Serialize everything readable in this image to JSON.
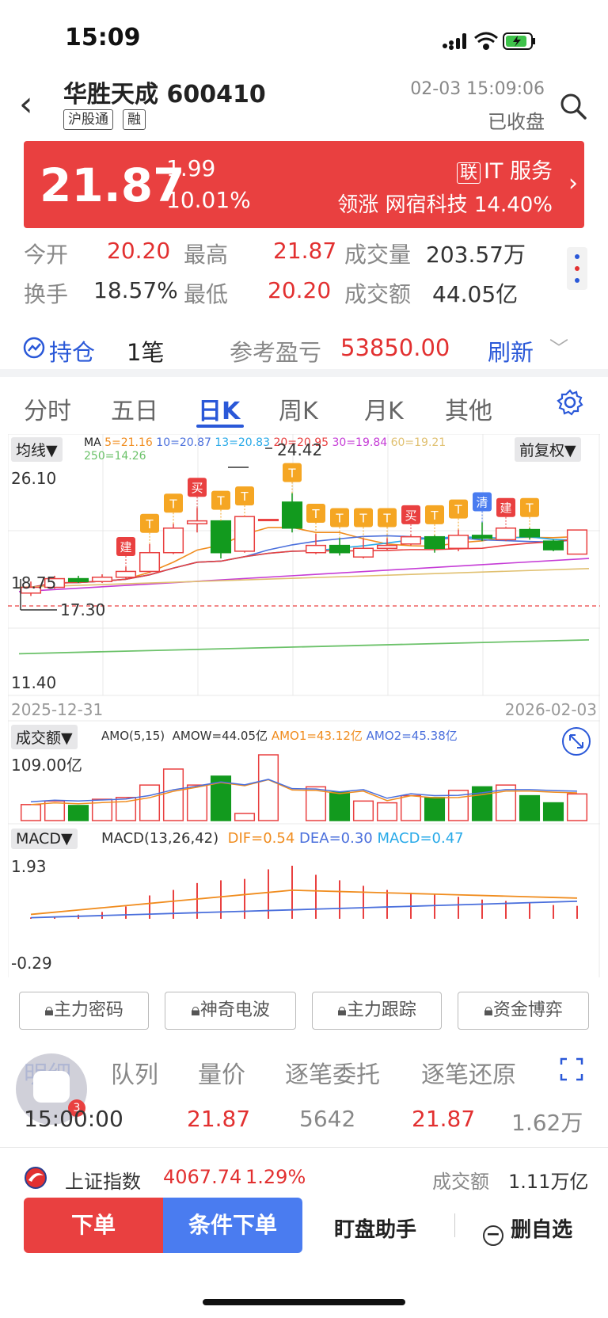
{
  "status_bar": {
    "time": "15:09"
  },
  "header": {
    "back_label": "‹",
    "stock_name": "华胜天成 600410",
    "tags": [
      "沪股通",
      "融"
    ],
    "datetime": "02-03 15:09:06",
    "market_status": "已收盘"
  },
  "quote": {
    "price": "21.87",
    "change": "1.99",
    "change_pct": "10.01%",
    "sector_badge": "联",
    "sector": "IT 服务",
    "leader_label": "领涨",
    "leader_name": "网宿科技",
    "leader_pct": "14.40%",
    "colors": {
      "up": "#e94040",
      "down": "#129a1e",
      "accent": "#2a58d8"
    }
  },
  "stats": {
    "open_label": "今开",
    "open": "20.20",
    "high_label": "最高",
    "high": "21.87",
    "volume_label": "成交量",
    "volume": "203.57万",
    "turnover_label": "换手",
    "turnover": "18.57%",
    "low_label": "最低",
    "low": "20.20",
    "amount_label": "成交额",
    "amount": "44.05亿"
  },
  "holding": {
    "label": "持仓",
    "count": "1笔",
    "pnl_label": "参考盈亏",
    "pnl": "53850.00",
    "refresh": "刷新"
  },
  "tabs": [
    "分时",
    "五日",
    "日K",
    "周K",
    "月K",
    "其他"
  ],
  "active_tab": "日K",
  "kline": {
    "indicator_btn": "均线▼",
    "ma_label": "MA",
    "ma": [
      {
        "label": "5=21.16",
        "color": "#f08c1e"
      },
      {
        "label": "10=20.87",
        "color": "#4a6fdc"
      },
      {
        "label": "13=20.83",
        "color": "#27a9e8"
      },
      {
        "label": "20=20.95",
        "color": "#e84040"
      },
      {
        "label": "30=19.84",
        "color": "#c53cd6"
      },
      {
        "label": "60=19.21",
        "color": "#e0c070"
      },
      {
        "label": "250=14.26",
        "color": "#6cc26a"
      }
    ],
    "adjust_btn": "前复权▼",
    "y_top": "26.10",
    "y_mid": "18.75",
    "y_bottom": "11.40",
    "max_label": "24.42",
    "min_label": "17.30",
    "date_start": "2025-12-31",
    "date_end": "2026-02-03",
    "signals": [
      "建",
      "T",
      "T",
      "买",
      "T",
      "T",
      "T",
      "T",
      "T",
      "T",
      "T",
      "买",
      "T",
      "T",
      "清",
      "建",
      "T"
    ]
  },
  "amount_panel": {
    "btn": "成交额▼",
    "amo": "AMO(5,15)",
    "amow": "AMOW=44.05亿",
    "amo1": "AMO1=43.12亿",
    "amo2": "AMO2=45.38亿",
    "y_top": "109.00亿"
  },
  "macd_panel": {
    "btn": "MACD▼",
    "macd": "MACD(13,26,42)",
    "dif": "DIF=0.54",
    "dea": "DEA=0.30",
    "macd_val": "MACD=0.47",
    "y_top": "1.93",
    "y_bottom": "-0.29"
  },
  "chart_data": {
    "type": "candlestick",
    "dates_range": [
      "2025-12-31",
      "2026-02-03"
    ],
    "ylim": [
      11.4,
      26.1
    ],
    "candles": [
      {
        "o": 17.5,
        "c": 17.9,
        "h": 18.3,
        "l": 17.3
      },
      {
        "o": 17.9,
        "c": 18.5,
        "h": 18.7,
        "l": 17.8
      },
      {
        "o": 18.5,
        "c": 18.3,
        "h": 18.7,
        "l": 18.2
      },
      {
        "o": 18.3,
        "c": 18.6,
        "h": 18.8,
        "l": 18.2
      },
      {
        "o": 18.6,
        "c": 19.0,
        "h": 19.3,
        "l": 18.5
      },
      {
        "o": 19.0,
        "c": 20.3,
        "h": 20.9,
        "l": 18.9
      },
      {
        "o": 20.3,
        "c": 22.0,
        "h": 22.3,
        "l": 20.2
      },
      {
        "o": 22.3,
        "c": 22.5,
        "h": 23.4,
        "l": 21.7
      },
      {
        "o": 22.5,
        "c": 20.3,
        "h": 22.5,
        "l": 19.9
      },
      {
        "o": 20.4,
        "c": 22.8,
        "h": 22.8,
        "l": 20.3
      },
      {
        "o": 22.6,
        "c": 22.6,
        "h": 22.6,
        "l": 22.6
      },
      {
        "o": 23.8,
        "c": 22.0,
        "h": 24.42,
        "l": 21.7
      },
      {
        "o": 20.3,
        "c": 20.8,
        "h": 21.6,
        "l": 20.2
      },
      {
        "o": 20.8,
        "c": 20.3,
        "h": 21.3,
        "l": 20.1
      },
      {
        "o": 20.0,
        "c": 20.6,
        "h": 21.3,
        "l": 19.9
      },
      {
        "o": 20.6,
        "c": 20.8,
        "h": 21.3,
        "l": 20.5
      },
      {
        "o": 20.9,
        "c": 21.4,
        "h": 21.5,
        "l": 20.8
      },
      {
        "o": 21.4,
        "c": 20.6,
        "h": 21.5,
        "l": 20.3
      },
      {
        "o": 20.6,
        "c": 21.5,
        "h": 21.9,
        "l": 20.4
      },
      {
        "o": 21.5,
        "c": 21.3,
        "h": 22.4,
        "l": 21.1
      },
      {
        "o": 21.2,
        "c": 22.0,
        "h": 22.0,
        "l": 21.1
      },
      {
        "o": 21.9,
        "c": 21.4,
        "h": 22.0,
        "l": 21.2
      },
      {
        "o": 21.1,
        "c": 20.5,
        "h": 21.2,
        "l": 20.4
      },
      {
        "o": 20.2,
        "c": 21.87,
        "h": 21.87,
        "l": 20.2
      }
    ],
    "amounts": [
      18,
      22,
      17,
      24,
      26,
      40,
      58,
      40,
      50,
      8,
      74,
      0,
      38,
      32,
      22,
      20,
      28,
      26,
      34,
      38,
      40,
      28,
      20,
      30
    ],
    "macd_bars": [
      0.05,
      0.08,
      0.15,
      0.25,
      0.45,
      0.85,
      1.05,
      1.3,
      1.4,
      1.45,
      1.8,
      1.93,
      1.6,
      1.4,
      1.2,
      1.05,
      0.95,
      0.9,
      0.8,
      0.7,
      0.65,
      0.6,
      0.5,
      0.47
    ]
  },
  "feature_buttons": [
    "主力密码",
    "神奇电波",
    "主力跟踪",
    "资金博弈"
  ],
  "detail_tabs": [
    "明细",
    "队列",
    "量价",
    "逐笔委托",
    "逐笔还原"
  ],
  "trade_row": {
    "time": "15:00:00",
    "price": "21.87",
    "volume": "5642",
    "price2": "21.87",
    "amount": "1.62万"
  },
  "index_bar": {
    "name": "上证指数",
    "value": "4067.74",
    "pct": "1.29%",
    "amount_label": "成交额",
    "amount": "1.11万亿"
  },
  "bottom_bar": {
    "order": "下单",
    "cond_order": "条件下单",
    "helper": "盯盘助手",
    "remove": "删自选"
  }
}
